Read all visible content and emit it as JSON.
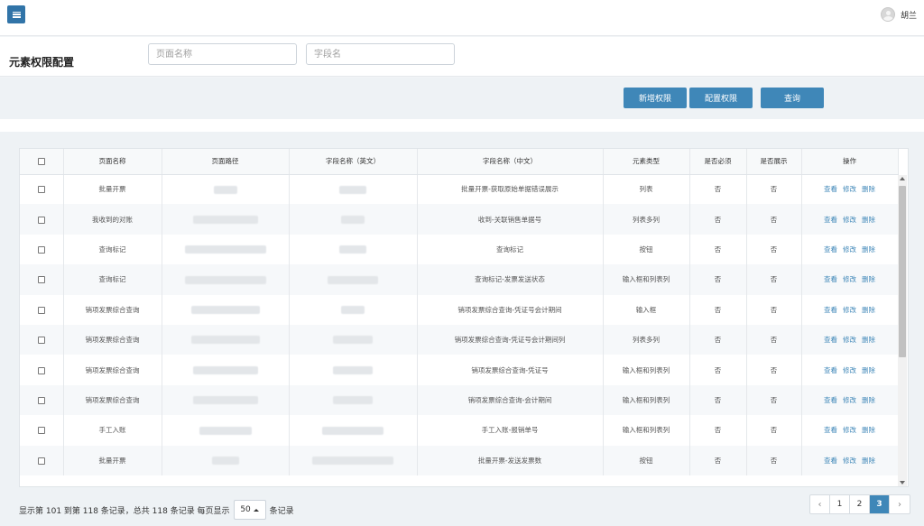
{
  "header": {
    "username": "胡兰"
  },
  "page": {
    "title": "元素权限配置"
  },
  "filters": {
    "page_name_placeholder": "页面名称",
    "field_name_placeholder": "字段名"
  },
  "actions": {
    "add_label": "新增权限",
    "config_label": "配置权限",
    "query_label": "查询"
  },
  "table": {
    "headers": {
      "page_name": "页面名称",
      "page_path": "页面路径",
      "field_en": "字段名称（英文）",
      "field_cn": "字段名称（中文）",
      "element_type": "元素类型",
      "required": "是否必须",
      "shown": "是否展示",
      "ops": "操作"
    },
    "op_labels": {
      "view": "查看",
      "edit": "修改",
      "delete": "删除"
    },
    "rows": [
      {
        "page_name": "批量开票",
        "field_cn": "批量开票-获取原始单据错误展示",
        "element_type": "列表",
        "required": "否",
        "shown": "否"
      },
      {
        "page_name": "我收到的对账",
        "field_cn": "收到-关联销售单据号",
        "element_type": "列表多列",
        "required": "否",
        "shown": "否"
      },
      {
        "page_name": "查询标记",
        "field_cn": "查询标记",
        "element_type": "按钮",
        "required": "否",
        "shown": "否"
      },
      {
        "page_name": "查询标记",
        "field_cn": "查询标记-发票发送状态",
        "element_type": "输入框和列表列",
        "required": "否",
        "shown": "否"
      },
      {
        "page_name": "销项发票综合查询",
        "field_cn": "销项发票综合查询-凭证号会计期间",
        "element_type": "输入框",
        "required": "否",
        "shown": "否"
      },
      {
        "page_name": "销项发票综合查询",
        "field_cn": "销项发票综合查询-凭证号会计期间列",
        "element_type": "列表多列",
        "required": "否",
        "shown": "否"
      },
      {
        "page_name": "销项发票综合查询",
        "field_cn": "销项发票综合查询-凭证号",
        "element_type": "输入框和列表列",
        "required": "否",
        "shown": "否"
      },
      {
        "page_name": "销项发票综合查询",
        "field_cn": "销项发票综合查询-会计期间",
        "element_type": "输入框和列表列",
        "required": "否",
        "shown": "否"
      },
      {
        "page_name": "手工入账",
        "field_cn": "手工入账-报销单号",
        "element_type": "输入框和列表列",
        "required": "否",
        "shown": "否"
      },
      {
        "page_name": "批量开票",
        "field_cn": "批量开票-发送发票数",
        "element_type": "按钮",
        "required": "否",
        "shown": "否"
      }
    ]
  },
  "footer": {
    "info_text": "显示第 101 到第 118 条记录，总共 118 条记录 每页显示",
    "page_size": "50",
    "info_suffix": "条记录",
    "pages": [
      "1",
      "2",
      "3"
    ],
    "current_page": "3",
    "prev_label": "‹",
    "next_label": "›"
  }
}
